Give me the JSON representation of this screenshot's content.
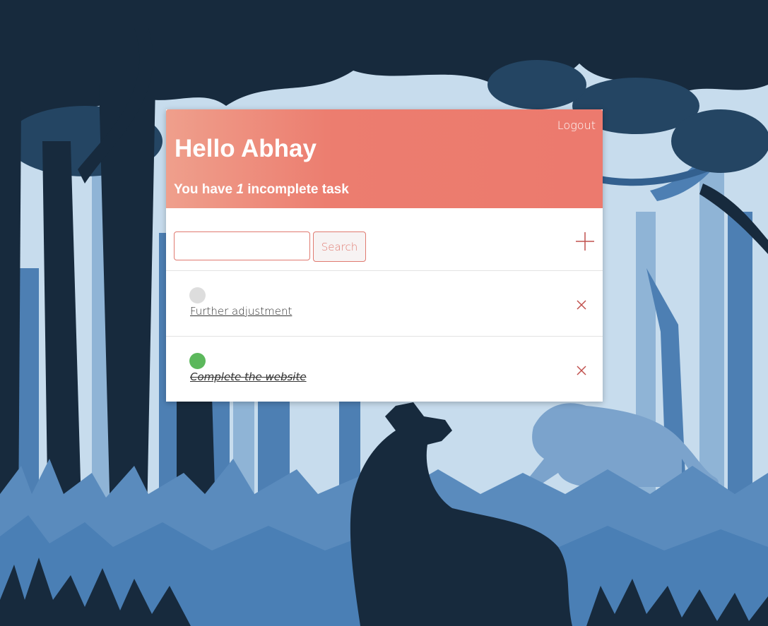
{
  "header": {
    "logout_label": "Logout",
    "greeting": "Hello Abhay",
    "summary_prefix": "You have ",
    "incomplete_count": "1",
    "summary_suffix": " incomplete task"
  },
  "search": {
    "value": "",
    "placeholder": "",
    "button_label": "Search"
  },
  "add_icon": "plus-icon",
  "delete_icon": "close-icon",
  "tasks": [
    {
      "title": "Further adjustment",
      "completed": false,
      "status_color": "#dddddd"
    },
    {
      "title": "Complete the website",
      "completed": true,
      "status_color": "#5cb85c"
    }
  ],
  "colors": {
    "accent": "#e07a70",
    "header_start": "#ef9f8c",
    "header_end": "#ec7a6e",
    "forest_dark": "#172a3d",
    "forest_mid": "#3a6b9c",
    "forest_light": "#c7dced"
  }
}
